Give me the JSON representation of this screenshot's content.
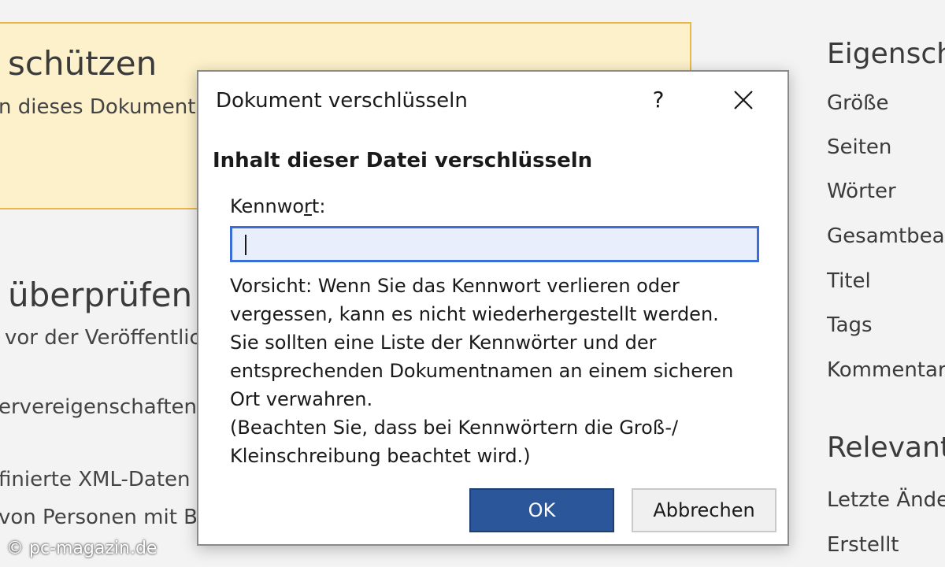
{
  "background": {
    "protect": {
      "title": "schützen",
      "description": "n dieses Dokuments"
    },
    "inspect": {
      "title": "überprüfen",
      "description": "vor der Veröffentlic",
      "items": [
        "ervereigenschaften",
        "finierte XML-Daten",
        "von Personen mit B"
      ]
    },
    "properties": {
      "heading": "Eigenscha",
      "labels": [
        "Größe",
        "Seiten",
        "Wörter",
        "Gesamtbear",
        "Titel",
        "Tags",
        "Kommentar"
      ],
      "related_heading": "Relevante",
      "related_labels": [
        "Letzte Ände",
        "Erstellt"
      ]
    },
    "watermark": "© pc-magazin.de"
  },
  "dialog": {
    "title": "Dokument verschlüsseln",
    "help_glyph": "?",
    "section_title": "Inhalt dieser Datei verschlüsseln",
    "password_label_before": "Kennwo",
    "password_label_accel": "r",
    "password_label_after": "t:",
    "password_value": "",
    "warning_lines": [
      "Vorsicht: Wenn Sie das Kennwort verlieren oder",
      "vergessen, kann es nicht wiederhergestellt werden.",
      "Sie sollten eine Liste der Kennwörter und der",
      "entsprechenden Dokumentnamen an einem sicheren",
      "Ort verwahren.",
      "(Beachten Sie, dass bei Kennwörtern die Groß-/",
      "Kleinschreibung beachtet wird.)"
    ],
    "ok_label": "OK",
    "cancel_label": "Abbrechen"
  },
  "colors": {
    "accent": "#2b579a",
    "input_focus": "#3b6dd8",
    "card_bg": "#fdf1cb",
    "card_border": "#e8b84a"
  }
}
